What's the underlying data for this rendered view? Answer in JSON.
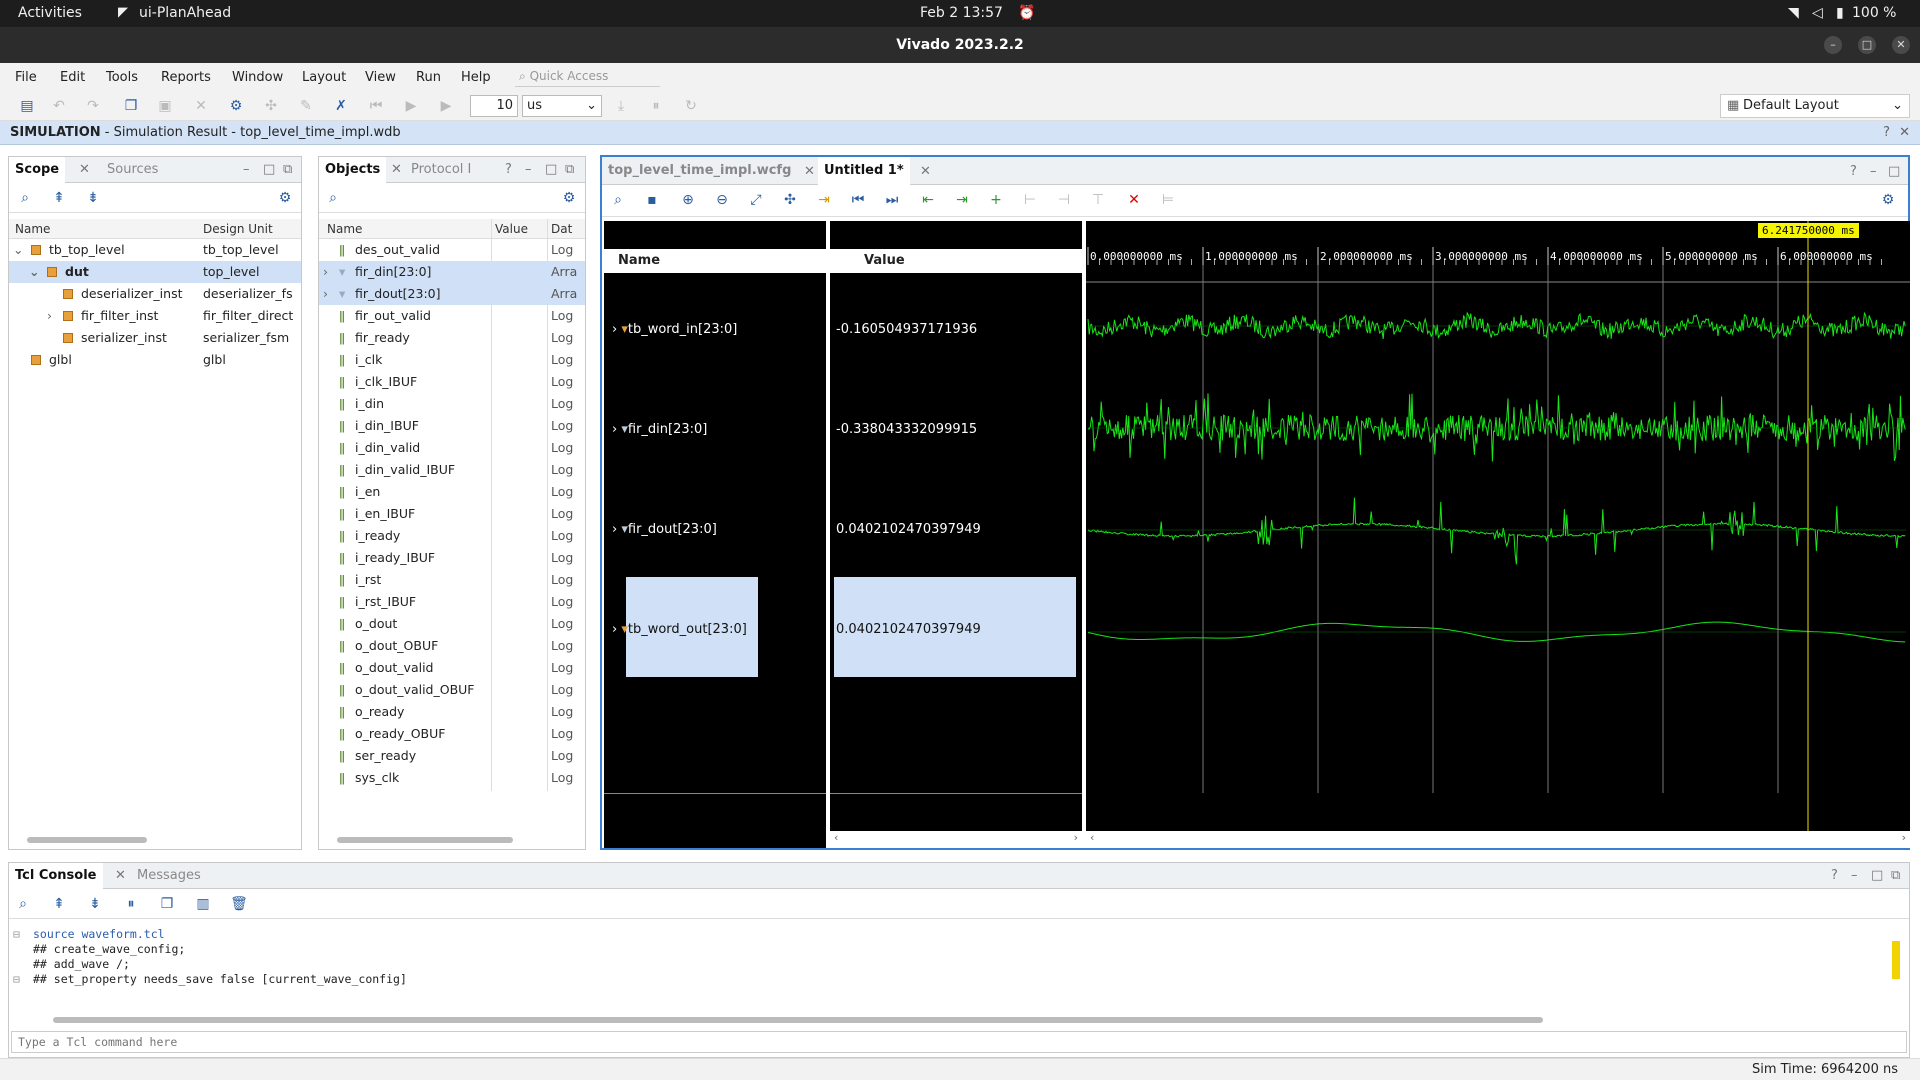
{
  "system_bar": {
    "activities": "Activities",
    "app": "ui-PlanAhead",
    "clock": "Feb 2  13:57",
    "battery": "100 %"
  },
  "window": {
    "title": "Vivado 2023.2.2"
  },
  "menu": [
    "File",
    "Edit",
    "Tools",
    "Reports",
    "Window",
    "Layout",
    "View",
    "Run",
    "Help"
  ],
  "quick_access": "Quick Access",
  "run_time": {
    "value": "10",
    "unit": "us"
  },
  "layout_select": "Default Layout",
  "sim_banner": {
    "label": "SIMULATION",
    "text": " - Simulation Result - top_level_time_impl.wdb"
  },
  "scope_panel": {
    "tabs": [
      "Scope",
      "Sources"
    ],
    "columns": [
      "Name",
      "Design Unit"
    ],
    "rows": [
      {
        "name": "tb_top_level",
        "unit": "tb_top_level"
      },
      {
        "name": "dut",
        "unit": "top_level"
      },
      {
        "name": "deserializer_inst",
        "unit": "deserializer_fs"
      },
      {
        "name": "fir_filter_inst",
        "unit": "fir_filter_direct"
      },
      {
        "name": "serializer_inst",
        "unit": "serializer_fsm"
      },
      {
        "name": "glbl",
        "unit": "glbl"
      }
    ]
  },
  "objects_panel": {
    "tabs": [
      "Objects",
      "Protocol I"
    ],
    "columns": [
      "Name",
      "Value",
      "Dat"
    ],
    "rows": [
      {
        "name": "des_out_valid",
        "type": "Log"
      },
      {
        "name": "fir_din[23:0]",
        "type": "Arra"
      },
      {
        "name": "fir_dout[23:0]",
        "type": "Arra"
      },
      {
        "name": "fir_out_valid",
        "type": "Log"
      },
      {
        "name": "fir_ready",
        "type": "Log"
      },
      {
        "name": "i_clk",
        "type": "Log"
      },
      {
        "name": "i_clk_IBUF",
        "type": "Log"
      },
      {
        "name": "i_din",
        "type": "Log"
      },
      {
        "name": "i_din_IBUF",
        "type": "Log"
      },
      {
        "name": "i_din_valid",
        "type": "Log"
      },
      {
        "name": "i_din_valid_IBUF",
        "type": "Log"
      },
      {
        "name": "i_en",
        "type": "Log"
      },
      {
        "name": "i_en_IBUF",
        "type": "Log"
      },
      {
        "name": "i_ready",
        "type": "Log"
      },
      {
        "name": "i_ready_IBUF",
        "type": "Log"
      },
      {
        "name": "i_rst",
        "type": "Log"
      },
      {
        "name": "i_rst_IBUF",
        "type": "Log"
      },
      {
        "name": "o_dout",
        "type": "Log"
      },
      {
        "name": "o_dout_OBUF",
        "type": "Log"
      },
      {
        "name": "o_dout_valid",
        "type": "Log"
      },
      {
        "name": "o_dout_valid_OBUF",
        "type": "Log"
      },
      {
        "name": "o_ready",
        "type": "Log"
      },
      {
        "name": "o_ready_OBUF",
        "type": "Log"
      },
      {
        "name": "ser_ready",
        "type": "Log"
      },
      {
        "name": "sys_clk",
        "type": "Log"
      }
    ]
  },
  "wave": {
    "tabs": [
      "top_level_time_impl.wcfg",
      "Untitled 1*"
    ],
    "name_header": "Name",
    "value_header": "Value",
    "cursor": "6.241750000 ms",
    "time_labels": [
      "0.000000000 ms",
      "1.000000000 ms",
      "2.000000000 ms",
      "3.000000000 ms",
      "4.000000000 ms",
      "5.000000000 ms",
      "6.000000000 ms"
    ],
    "signals": [
      {
        "name": "tb_word_in[23:0]",
        "value": "-0.160504937171936"
      },
      {
        "name": "fir_din[23:0]",
        "value": "-0.338043332099915"
      },
      {
        "name": "fir_dout[23:0]",
        "value": "0.0402102470397949"
      },
      {
        "name": "tb_word_out[23:0]",
        "value": "0.0402102470397949"
      }
    ]
  },
  "tcl": {
    "tabs": [
      "Tcl Console",
      "Messages"
    ],
    "lines": [
      "source waveform.tcl",
      "## create_wave_config;",
      "## add_wave /;",
      "## set_property needs_save false [current_wave_config]"
    ],
    "placeholder": "Type a Tcl command here"
  },
  "status": {
    "sim_time": "Sim Time: 6964200 ns"
  }
}
